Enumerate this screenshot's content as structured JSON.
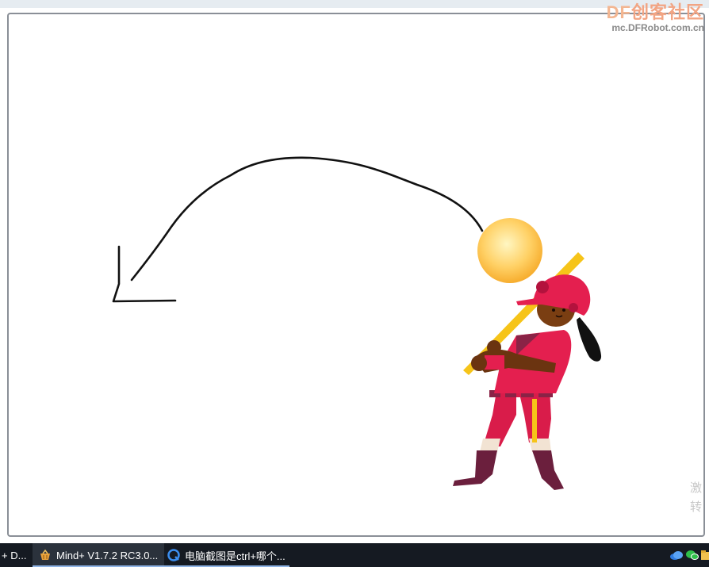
{
  "watermark": {
    "logo_df": "DF",
    "logo_cn": "创客社区",
    "url": "mc.DFRobot.com.cn"
  },
  "side_text": {
    "line1": "激",
    "line2": "转"
  },
  "taskbar": {
    "items": [
      {
        "label": "+ D..."
      },
      {
        "label": "Mind+ V1.7.2 RC3.0...",
        "icon": "mindplus-basket-icon"
      },
      {
        "label": "电脑截图是ctrl+哪个...",
        "icon": "browser-q-icon"
      }
    ],
    "tray_icons": [
      "cloud-icon",
      "wechat-icon",
      "folder-icon"
    ]
  },
  "colors": {
    "stage_border": "#8a8f97",
    "ball": "#ffc857",
    "uniform": "#e41f4f",
    "helmet": "#e41f4f",
    "bat": "#f6c419",
    "taskbar": "#151a22"
  }
}
